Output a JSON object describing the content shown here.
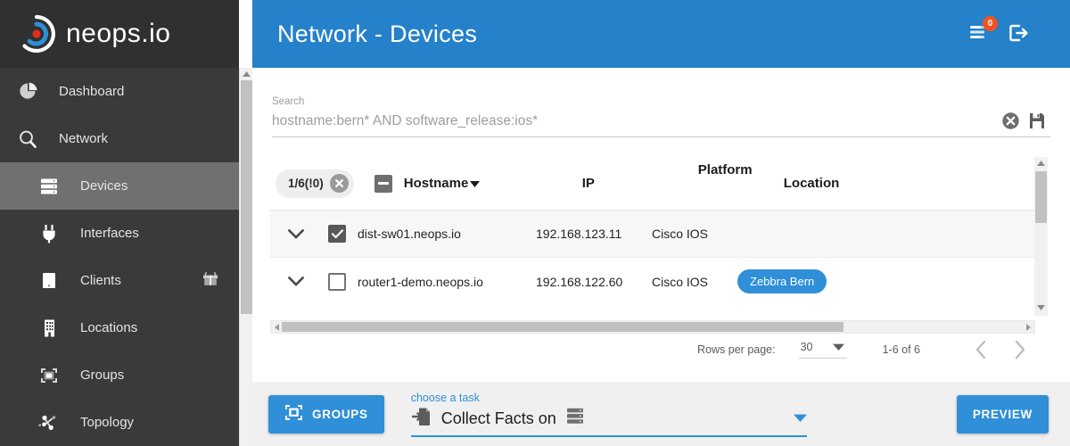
{
  "brand": {
    "name": "neops.io",
    "logo_icon": "neops-target-logo",
    "accent_blue": "#2581c9",
    "sidebar_bg": "#3a3a3a",
    "sidebar_active_bg": "#707070",
    "badge_red": "#f4511e"
  },
  "sidebar": {
    "items": [
      {
        "label": "Dashboard",
        "icon": "pie-chart-icon",
        "level": "top",
        "active": false
      },
      {
        "label": "Network",
        "icon": "magnifier-icon",
        "level": "top",
        "active": false
      },
      {
        "label": "Devices",
        "icon": "server-rack-icon",
        "level": "sub",
        "active": true
      },
      {
        "label": "Interfaces",
        "icon": "plug-icon",
        "level": "sub",
        "active": false
      },
      {
        "label": "Clients",
        "icon": "tablet-icon",
        "level": "sub",
        "active": false,
        "trailing_icon": "gift-icon"
      },
      {
        "label": "Locations",
        "icon": "building-icon",
        "level": "sub",
        "active": false
      },
      {
        "label": "Groups",
        "icon": "group-frame-icon",
        "level": "sub",
        "active": false
      },
      {
        "label": "Topology",
        "icon": "topology-nodes-icon",
        "level": "sub",
        "active": false
      }
    ]
  },
  "header": {
    "title": "Network - Devices",
    "tasks_icon": "task-list-icon",
    "tasks_badge": "0",
    "logout_icon": "logout-icon"
  },
  "search": {
    "label": "Search",
    "value": "hostname:bern* AND software_release:ios*",
    "placeholder": "hostname:bern* AND software_release:ios*",
    "clear_icon": "clear-circle-icon",
    "save_icon": "save-disk-icon"
  },
  "table": {
    "selection_chip": {
      "label": "1/6(!0)",
      "clear_icon": "chip-clear-icon"
    },
    "header_checkbox_state": "indeterminate",
    "columns": [
      {
        "key": "hostname",
        "label": "Hostname",
        "sorted": true,
        "sort_icon": "sort-desc-arrow"
      },
      {
        "key": "ip",
        "label": "IP",
        "sorted": false
      },
      {
        "key": "platform",
        "label": "Platform",
        "sorted": false
      },
      {
        "key": "location",
        "label": "Location",
        "sorted": false
      }
    ],
    "rows": [
      {
        "expand_icon": "chevron-down-icon",
        "checked": true,
        "hostname": "dist-sw01.neops.io",
        "ip": "192.168.123.11",
        "platform": "Cisco IOS",
        "location": "",
        "location_is_pill": false
      },
      {
        "expand_icon": "chevron-down-icon",
        "checked": false,
        "hostname": "router1-demo.neops.io",
        "ip": "192.168.122.60",
        "platform": "Cisco IOS",
        "location": "Zebbra Bern",
        "location_is_pill": true
      }
    ]
  },
  "paginator": {
    "rows_per_page_label": "Rows per page:",
    "rows_per_page_value": "30",
    "dropdown_icon": "caret-down-icon",
    "range_label": "1-6 of 6",
    "prev_icon": "chevron-left-icon",
    "next_icon": "chevron-right-icon"
  },
  "bottom_bar": {
    "groups_button": {
      "label": "GROUPS",
      "icon": "group-frame-icon"
    },
    "task_select": {
      "label": "choose a task",
      "value": "Collect Facts on",
      "leading_icon": "import-file-icon",
      "value_suffix_icon": "server-rack-icon",
      "caret_icon": "caret-down-icon"
    },
    "preview_button": {
      "label": "PREVIEW"
    }
  },
  "scrollbars": {
    "sidebar_vertical": true,
    "table_vertical": true,
    "table_horizontal": true
  }
}
